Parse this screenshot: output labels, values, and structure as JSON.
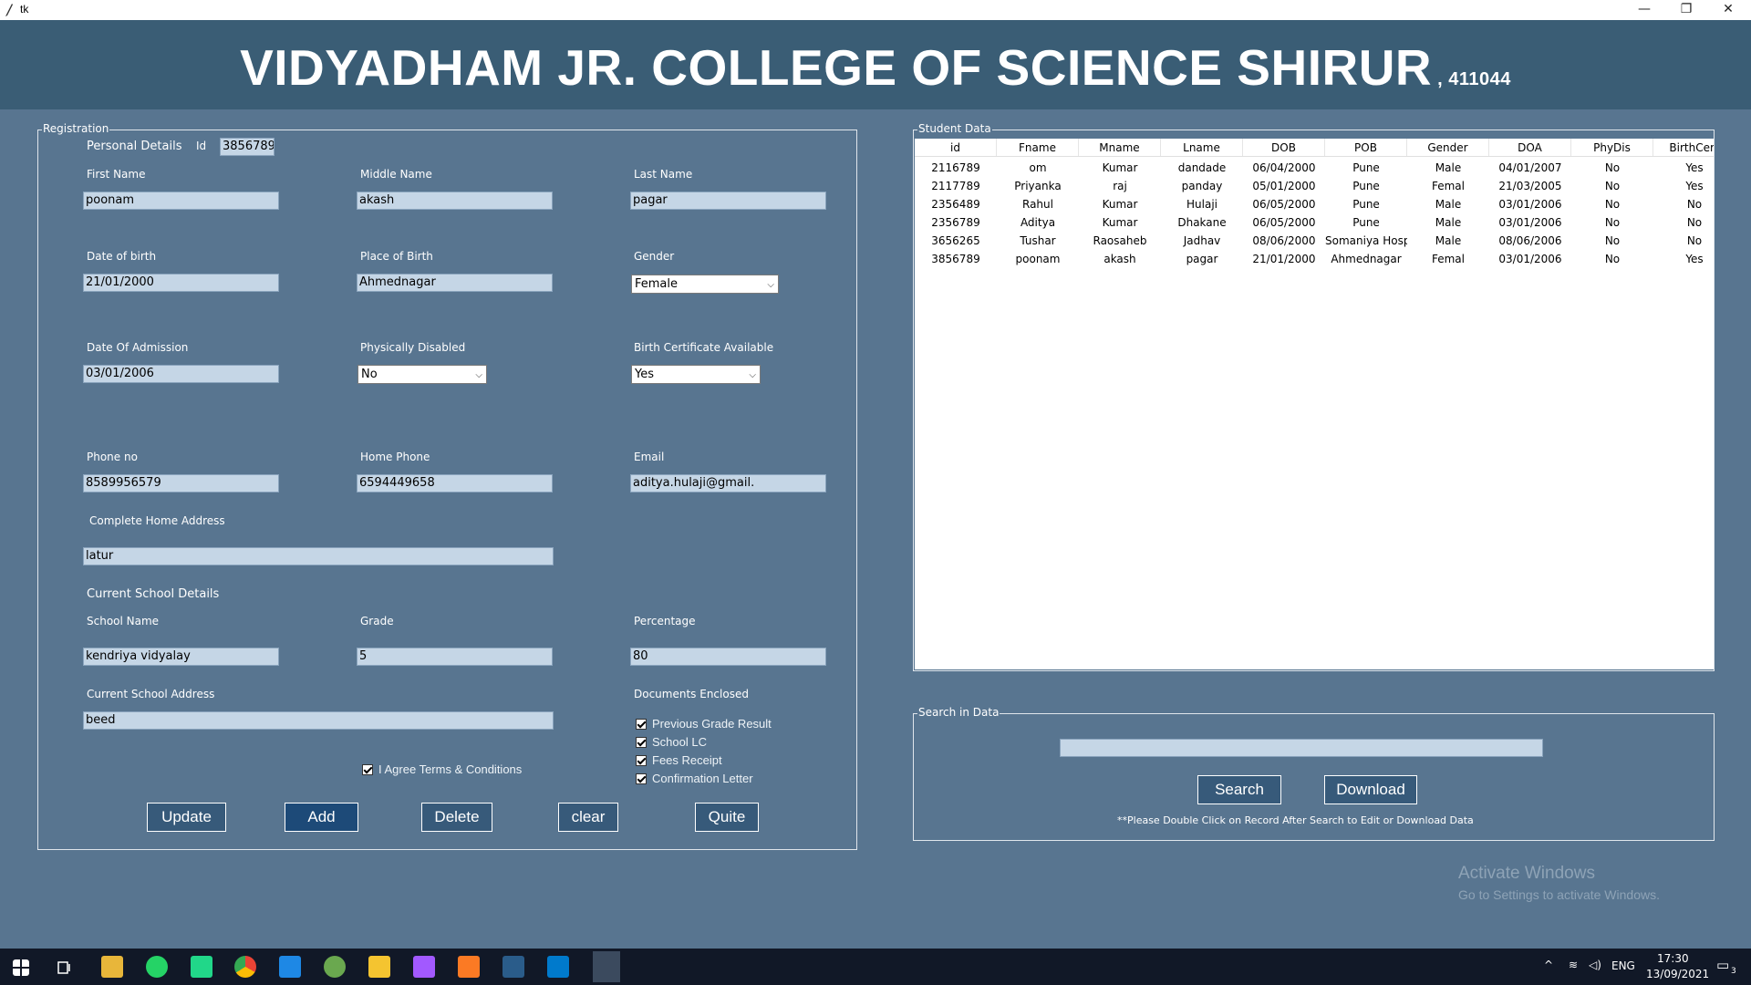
{
  "window": {
    "title": "tk"
  },
  "header": {
    "title": "VIDYADHAM JR. COLLEGE OF SCIENCE SHIRUR",
    "pin": ", 411044"
  },
  "registration": {
    "legend": "Registration",
    "personal_details": "Personal Details",
    "id_label": "Id",
    "id_value": "3856789",
    "first_name_label": "First Name",
    "first_name": "poonam",
    "middle_name_label": "Middle Name",
    "middle_name": "akash",
    "last_name_label": "Last Name",
    "last_name": "pagar",
    "dob_label": "Date of birth",
    "dob": "21/01/2000",
    "pob_label": "Place of Birth",
    "pob": "Ahmednagar",
    "gender_label": "Gender",
    "gender": "Female",
    "doa_label": "Date Of Admission",
    "doa": "03/01/2006",
    "phydis_label": "Physically Disabled",
    "phydis": "No",
    "birthcert_label": "Birth Certificate Available",
    "birthcert": "Yes",
    "phone_label": "Phone no",
    "phone": "8589956579",
    "home_phone_label": "Home Phone",
    "home_phone": "6594449658",
    "email_label": "Email",
    "email": "aditya.hulaji@gmail.",
    "address_label": "Complete Home Address",
    "address": "latur",
    "school_section": "Current School Details",
    "school_name_label": "School Name",
    "school_name": "kendriya vidyalay",
    "grade_label": "Grade",
    "grade": "5",
    "percentage_label": "Percentage",
    "percentage": "80",
    "school_address_label": "Current School Address",
    "school_address": "beed",
    "documents_label": "Documents Enclosed",
    "doc1": "Previous Grade Result",
    "doc2": "School LC",
    "doc3": "Fees Receipt",
    "doc4": "Confirmation Letter",
    "agree": "I Agree Terms & Conditions",
    "buttons": {
      "update": "Update",
      "add": "Add",
      "delete": "Delete",
      "clear": "clear",
      "quit": "Quite"
    }
  },
  "student_data": {
    "legend": "Student Data",
    "columns": [
      "id",
      "Fname",
      "Mname",
      "Lname",
      "DOB",
      "POB",
      "Gender",
      "DOA",
      "PhyDis",
      "BirthCert"
    ],
    "rows": [
      [
        "2116789",
        "om",
        "Kumar",
        "dandade",
        "06/04/2000",
        "Pune",
        "Male",
        "04/01/2007",
        "No",
        "Yes"
      ],
      [
        "2117789",
        "Priyanka",
        "raj",
        "panday",
        "05/01/2000",
        "Pune",
        "Femal",
        "21/03/2005",
        "No",
        "Yes"
      ],
      [
        "2356489",
        "Rahul",
        "Kumar",
        "Hulaji",
        "06/05/2000",
        "Pune",
        "Male",
        "03/01/2006",
        "No",
        "No"
      ],
      [
        "2356789",
        "Aditya",
        "Kumar",
        "Dhakane",
        "06/05/2000",
        "Pune",
        "Male",
        "03/01/2006",
        "No",
        "No"
      ],
      [
        "3656265",
        "Tushar",
        "Raosaheb",
        "Jadhav",
        "08/06/2000",
        "Somaniya Hosp",
        "Male",
        "08/06/2006",
        "No",
        "No"
      ],
      [
        "3856789",
        "poonam",
        "akash",
        "pagar",
        "21/01/2000",
        "Ahmednagar",
        "Femal",
        "03/01/2006",
        "No",
        "Yes"
      ]
    ]
  },
  "search": {
    "legend": "Search in Data",
    "value": "",
    "search_button": "Search",
    "download_button": "Download",
    "note": "**Please Double Click on Record After Search to Edit or Download Data"
  },
  "watermark": {
    "line1": "Activate Windows",
    "line2": "Go to Settings to activate Windows."
  },
  "taskbar": {
    "lang": "ENG",
    "time": "17:30",
    "date": "13/09/2021",
    "notif_count": "3"
  }
}
